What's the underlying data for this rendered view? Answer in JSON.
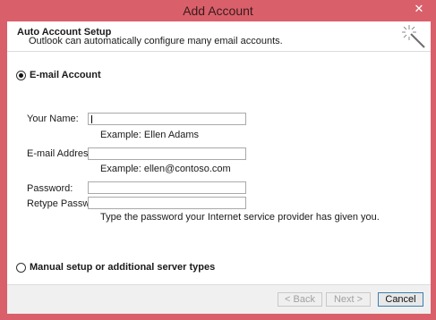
{
  "window": {
    "title": "Add Account",
    "close_glyph": "✕"
  },
  "header": {
    "title": "Auto Account Setup",
    "subtitle": "Outlook can automatically configure many email accounts.",
    "icon": "wand-icon"
  },
  "options": {
    "email_account": {
      "label": "E-mail Account",
      "selected": true
    },
    "manual_setup": {
      "label": "Manual setup or additional server types",
      "selected": false
    }
  },
  "form": {
    "name": {
      "label": "Your Name:",
      "value": "",
      "hint": "Example: Ellen Adams"
    },
    "email": {
      "label": "E-mail Address:",
      "value": "",
      "hint": "Example: ellen@contoso.com"
    },
    "password": {
      "label": "Password:",
      "value": ""
    },
    "retype_password": {
      "label": "Retype Password:",
      "value": "",
      "hint": "Type the password your Internet service provider has given you."
    }
  },
  "footer": {
    "back_label": "< Back",
    "next_label": "Next >",
    "cancel_label": "Cancel"
  },
  "colors": {
    "title_bar": "#d9606a",
    "accent_border": "#3c7fb1"
  }
}
